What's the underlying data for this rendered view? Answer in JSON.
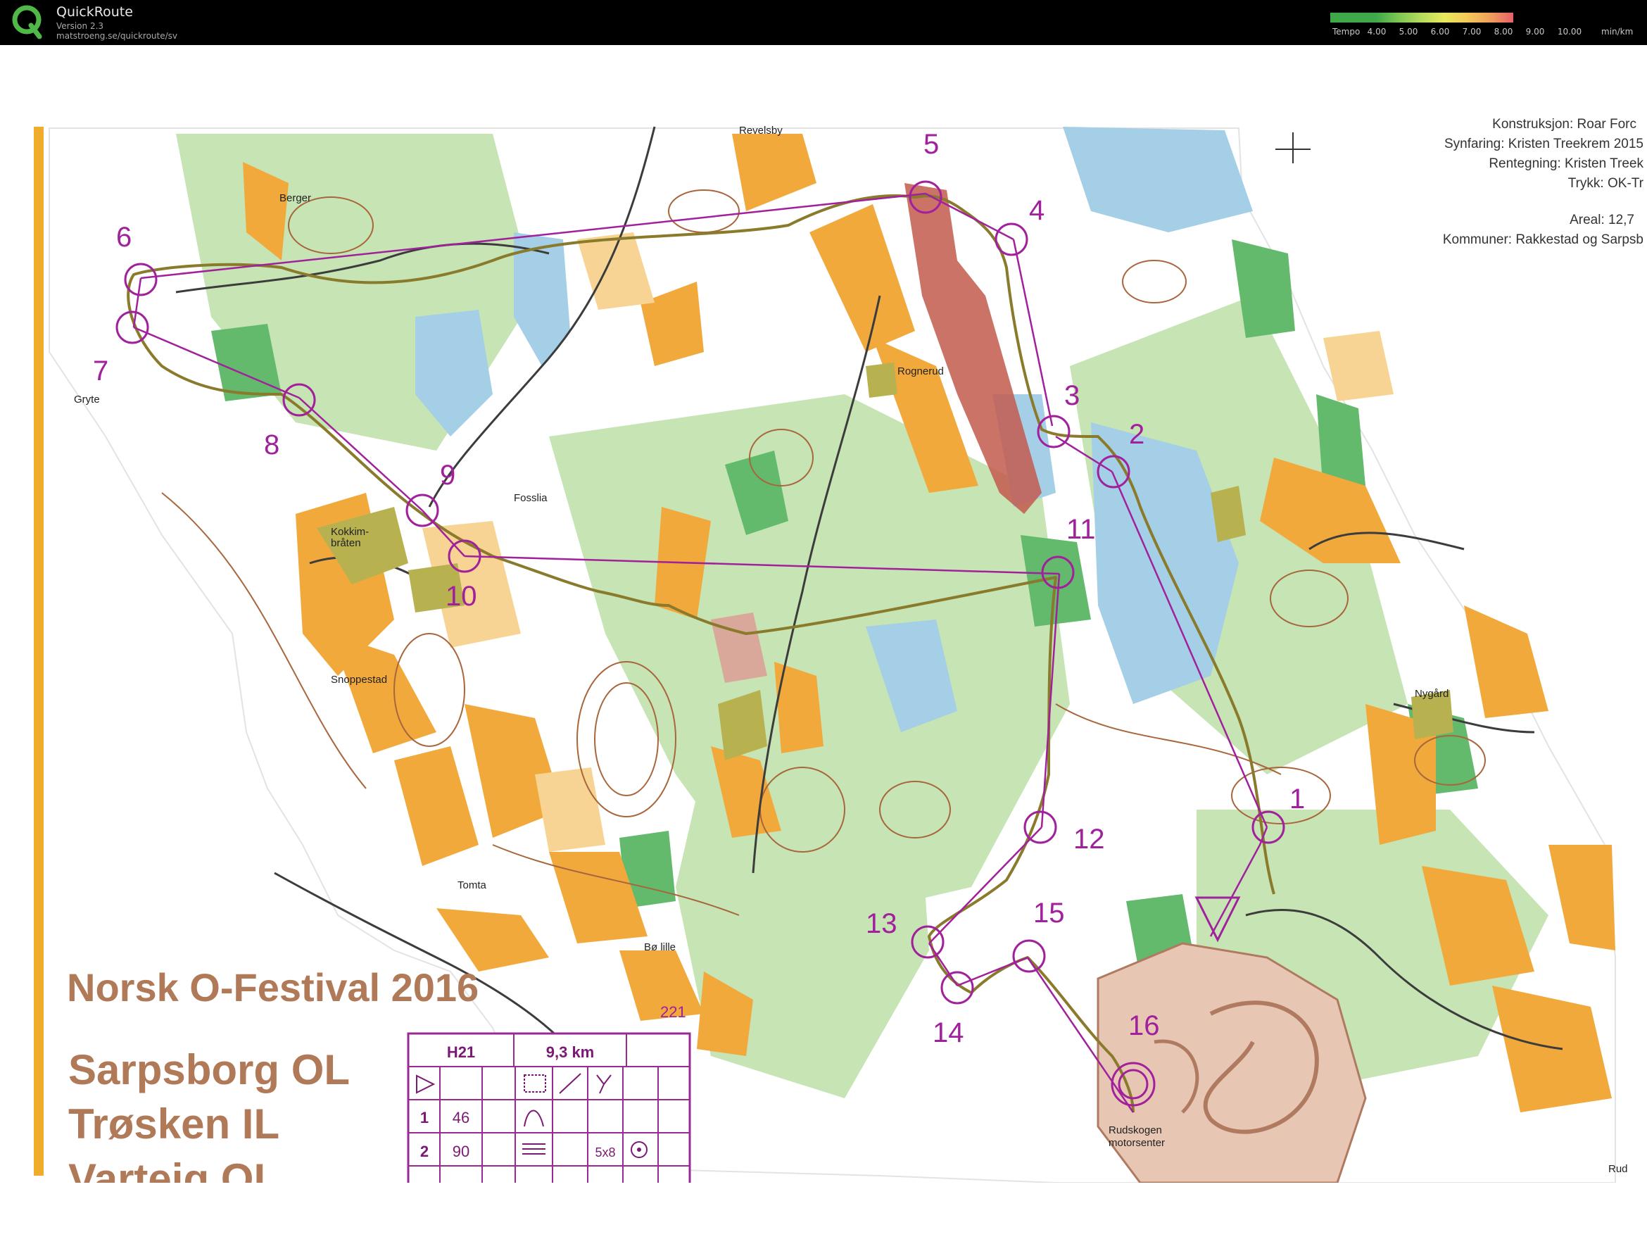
{
  "app": {
    "title": "QuickRoute",
    "version": "Version 2.3",
    "url": "matstroeng.se/quickroute/sv"
  },
  "pace_legend": {
    "label": "Tempo",
    "unit": "min/km",
    "ticks": [
      "4.00",
      "5.00",
      "6.00",
      "7.00",
      "8.00",
      "9.00",
      "10.00"
    ],
    "colors": [
      "#3ea84a",
      "#7cc552",
      "#b5dc5c",
      "#e8e95c",
      "#f5c95a",
      "#f0a05a",
      "#e8606a"
    ]
  },
  "map": {
    "colors": {
      "forest": "#ffffff",
      "runnable": "#c6e4b4",
      "green": "#63b96c",
      "open": "#f2a93c",
      "rough_open": "#f7d494",
      "marsh": "#a4cfe6",
      "water": "#8cc3e3",
      "private": "#c35a4e",
      "contour": "#a8663c",
      "course": "#a1209c",
      "route": "#8a7a2c",
      "frame": "#f0ad2c",
      "title_text": "#b07a58"
    },
    "place_names": [
      "Revelsby",
      "Berger",
      "Gryte",
      "Rognerud",
      "Fosslia",
      "Kokkim-",
      "bråten",
      "Snoppestad",
      "Tomta",
      "Bø lille",
      "Nygård",
      "Rudskogen",
      "motorsenter",
      "Rud"
    ],
    "credits": [
      "Konstruksjon: Roar Forc",
      "Synfaring: Kristen Treekrem 2015",
      "Rentegning: Kristen Treek",
      "Trykk: OK-Tr",
      "Areal: 12,7",
      "Kommuner: Rakkestad og Sarpsb"
    ],
    "map_title": "Norsk O-Festival 2016",
    "clubs": [
      "Sarpsborg OL",
      "Trøsken IL",
      "Varteig OL"
    ],
    "map_number": "221",
    "controls": [
      "1",
      "2",
      "3",
      "4",
      "5",
      "6",
      "7",
      "8",
      "9",
      "10",
      "11",
      "12",
      "13",
      "14",
      "15",
      "16"
    ]
  },
  "control_card": {
    "class": "H21",
    "length": "9,3 km",
    "rows": [
      {
        "num": "1",
        "code": "46"
      },
      {
        "num": "2",
        "code": "90",
        "dim": "5x8"
      }
    ]
  }
}
